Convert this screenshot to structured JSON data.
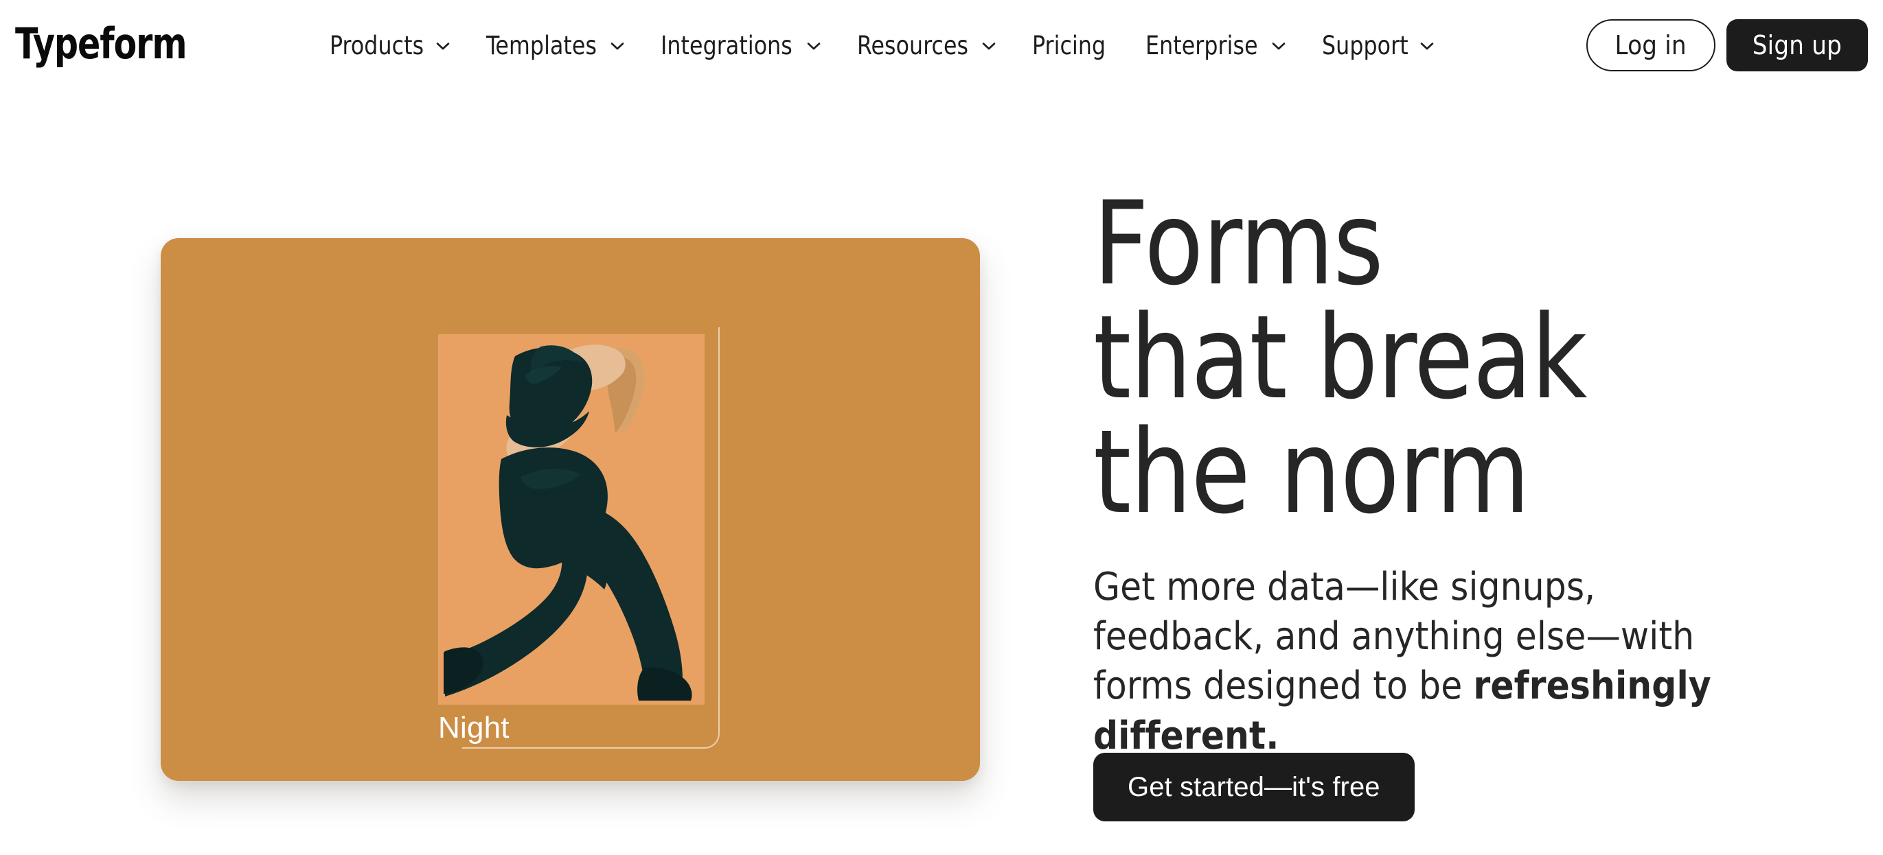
{
  "brand": {
    "name": "Typeform",
    "accent_dark": "#1C1C1C",
    "card_ochre": "#CC8D44",
    "photo_bg": "#E8A163",
    "apparel": "#0E2A2B"
  },
  "nav": {
    "items": [
      {
        "label": "Products",
        "has_dropdown": true,
        "icon": "chevron-down-icon"
      },
      {
        "label": "Templates",
        "has_dropdown": true,
        "icon": "chevron-down-icon"
      },
      {
        "label": "Integrations",
        "has_dropdown": true,
        "icon": "chevron-down-icon"
      },
      {
        "label": "Resources",
        "has_dropdown": true,
        "icon": "chevron-down-icon"
      },
      {
        "label": "Pricing",
        "has_dropdown": false,
        "icon": ""
      },
      {
        "label": "Enterprise",
        "has_dropdown": true,
        "icon": "chevron-down-icon"
      },
      {
        "label": "Support",
        "has_dropdown": true,
        "icon": "chevron-down-icon"
      }
    ],
    "login_label": "Log in",
    "signup_label": "Sign up"
  },
  "hero": {
    "headline": "Forms\nthat break\nthe norm",
    "sub_plain": "Get more data—like signups, feedback, and anything else—with forms designed to be ",
    "sub_bold": "refreshingly different.",
    "cta_label": "Get started—it's free",
    "card": {
      "photo_label": "Night"
    }
  }
}
